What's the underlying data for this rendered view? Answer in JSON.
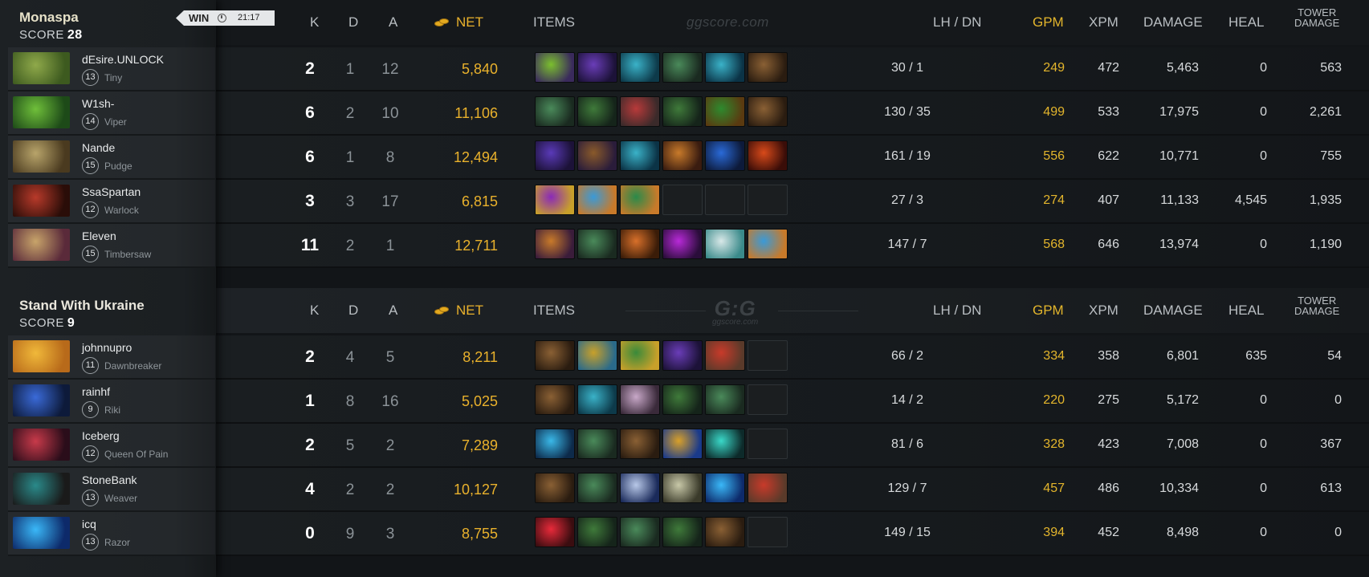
{
  "result": {
    "label": "WIN",
    "time": "21:17"
  },
  "headers": {
    "k": "K",
    "d": "D",
    "a": "A",
    "net": "NET",
    "items": "ITEMS",
    "lhdn": "LH  /  DN",
    "gpm": "GPM",
    "xpm": "XPM",
    "damage": "DAMAGE",
    "heal": "HEAL",
    "tower1": "TOWER",
    "tower2": "DAMAGE",
    "watermark": "ggscore.com",
    "watermark_logo": "G:G",
    "watermark_sub": "ggscore.com"
  },
  "teams": [
    {
      "name": "Monaspa",
      "score_label": "SCORE",
      "score": "28",
      "players": [
        {
          "name": "dEsire.UNLOCK",
          "level": "13",
          "hero": "Tiny",
          "k": "2",
          "d": "1",
          "a": "12",
          "net": "5,840",
          "lhdn": "30  /  1",
          "gpm": "249",
          "xpm": "472",
          "damage": "5,463",
          "heal": "0",
          "tower": "563",
          "portrait": [
            "#8fa94a",
            "#3d5a1f"
          ],
          "items": [
            [
              "#7bbf2e",
              "#3a2a5c"
            ],
            [
              "#6a3db8",
              "#1c1238"
            ],
            [
              "#3ab2c8",
              "#0d3a4a"
            ],
            [
              "#4a8a5a",
              "#1a2a20"
            ],
            [
              "#3ab2c8",
              "#0b3346"
            ],
            [
              "#8a6034",
              "#2a1c10"
            ]
          ]
        },
        {
          "name": "W1sh-",
          "level": "14",
          "hero": "Viper",
          "k": "6",
          "d": "2",
          "a": "10",
          "net": "11,106",
          "lhdn": "130  /  35",
          "gpm": "499",
          "xpm": "533",
          "damage": "17,975",
          "heal": "0",
          "tower": "2,261",
          "portrait": [
            "#6fbf3a",
            "#1d4a18"
          ],
          "items": [
            [
              "#4a8a5a",
              "#1a2a20"
            ],
            [
              "#3f7a3a",
              "#15241a"
            ],
            [
              "#b83a3a",
              "#3a2a2a"
            ],
            [
              "#3f7a3a",
              "#15241a"
            ],
            [
              "#2e8a2e",
              "#5a3a10"
            ],
            [
              "#8a6034",
              "#2a1c10"
            ]
          ]
        },
        {
          "name": "Nande",
          "level": "15",
          "hero": "Pudge",
          "k": "6",
          "d": "1",
          "a": "8",
          "net": "12,494",
          "lhdn": "161  /  19",
          "gpm": "556",
          "xpm": "622",
          "damage": "10,771",
          "heal": "0",
          "tower": "755",
          "portrait": [
            "#b8a46a",
            "#4a3a1f"
          ],
          "items": [
            [
              "#5a3ab8",
              "#1c1238"
            ],
            [
              "#8a5a2a",
              "#2a1c3a"
            ],
            [
              "#3ab2c8",
              "#0b3346"
            ],
            [
              "#c87a2a",
              "#3a1c10"
            ],
            [
              "#2a6ad8",
              "#0d1a3a"
            ],
            [
              "#d84a1a",
              "#3a0d08"
            ]
          ]
        },
        {
          "name": "SsaSpartan",
          "level": "12",
          "hero": "Warlock",
          "k": "3",
          "d": "3",
          "a": "17",
          "net": "6,815",
          "lhdn": "27  /  3",
          "gpm": "274",
          "xpm": "407",
          "damage": "11,133",
          "heal": "4,545",
          "tower": "1,935",
          "portrait": [
            "#b83a2a",
            "#2a0d08"
          ],
          "items": [
            [
              "#8a2ab8",
              "#c8a02a"
            ],
            [
              "#3a9ad8",
              "#c87a2a"
            ],
            [
              "#2a8a4a",
              "#c87a2a"
            ],
            null,
            null,
            null
          ]
        },
        {
          "name": "Eleven",
          "level": "15",
          "hero": "Timbersaw",
          "k": "11",
          "d": "2",
          "a": "1",
          "net": "12,711",
          "lhdn": "147  /  7",
          "gpm": "568",
          "xpm": "646",
          "damage": "13,974",
          "heal": "0",
          "tower": "1,190",
          "portrait": [
            "#c8a46a",
            "#5a2a3a"
          ],
          "items": [
            [
              "#c87a2a",
              "#3a1c3a"
            ],
            [
              "#4a8a5a",
              "#1a2a20"
            ],
            [
              "#d8702a",
              "#3a1c08"
            ],
            [
              "#b82ad8",
              "#2a0d3a"
            ],
            [
              "#d8e8e8",
              "#3a8a8a"
            ],
            [
              "#3a9ad8",
              "#c87a2a"
            ]
          ]
        }
      ]
    },
    {
      "name": "Stand With Ukraine",
      "score_label": "SCORE",
      "score": "9",
      "players": [
        {
          "name": "johnnupro",
          "level": "11",
          "hero": "Dawnbreaker",
          "k": "2",
          "d": "4",
          "a": "5",
          "net": "8,211",
          "lhdn": "66  /  2",
          "gpm": "334",
          "xpm": "358",
          "damage": "6,801",
          "heal": "635",
          "tower": "54",
          "portrait": [
            "#f0b83a",
            "#b86a1a"
          ],
          "items": [
            [
              "#8a6034",
              "#2a1c10"
            ],
            [
              "#c8a02a",
              "#2a6a8a"
            ],
            [
              "#3a8a3a",
              "#c8a02a"
            ],
            [
              "#6a3db8",
              "#1c1238"
            ],
            [
              "#c83a2a",
              "#5a3a2a"
            ],
            null
          ]
        },
        {
          "name": "rainhf",
          "level": "9",
          "hero": "Riki",
          "k": "1",
          "d": "8",
          "a": "16",
          "net": "5,025",
          "lhdn": "14  /  2",
          "gpm": "220",
          "xpm": "275",
          "damage": "5,172",
          "heal": "0",
          "tower": "0",
          "portrait": [
            "#3a6ad8",
            "#0d1a3a"
          ],
          "items": [
            [
              "#8a6034",
              "#2a1c10"
            ],
            [
              "#3ab2c8",
              "#0d3a4a"
            ],
            [
              "#c8a8c8",
              "#3a2a3a"
            ],
            [
              "#3f7a3a",
              "#15241a"
            ],
            [
              "#4a8a5a",
              "#1a2a20"
            ],
            null
          ]
        },
        {
          "name": "Iceberg",
          "level": "12",
          "hero": "Queen Of Pain",
          "k": "2",
          "d": "5",
          "a": "2",
          "net": "7,289",
          "lhdn": "81  /  6",
          "gpm": "328",
          "xpm": "423",
          "damage": "7,008",
          "heal": "0",
          "tower": "367",
          "portrait": [
            "#c83a4a",
            "#2a0d1a"
          ],
          "items": [
            [
              "#3ab8e8",
              "#0d2a4a"
            ],
            [
              "#4a8a5a",
              "#1a2a20"
            ],
            [
              "#8a6034",
              "#2a1c10"
            ],
            [
              "#d8a02a",
              "#1a3a8a"
            ],
            [
              "#3ad8c8",
              "#0d2a2a"
            ],
            null
          ]
        },
        {
          "name": "StoneBank",
          "level": "13",
          "hero": "Weaver",
          "k": "4",
          "d": "2",
          "a": "2",
          "net": "10,127",
          "lhdn": "129  /  7",
          "gpm": "457",
          "xpm": "486",
          "damage": "10,334",
          "heal": "0",
          "tower": "613",
          "portrait": [
            "#2a8a8a",
            "#1a1a1a"
          ],
          "items": [
            [
              "#8a6034",
              "#2a1c10"
            ],
            [
              "#4a8a5a",
              "#1a2a20"
            ],
            [
              "#b8c8e8",
              "#1a2a5a"
            ],
            [
              "#c8c8a8",
              "#3a3a2a"
            ],
            [
              "#3ab8f8",
              "#0d2a6a"
            ],
            [
              "#c83a2a",
              "#5a3a2a"
            ]
          ]
        },
        {
          "name": "icq",
          "level": "13",
          "hero": "Razor",
          "k": "0",
          "d": "9",
          "a": "3",
          "net": "8,755",
          "lhdn": "149  /  15",
          "gpm": "394",
          "xpm": "452",
          "damage": "8,498",
          "heal": "0",
          "tower": "0",
          "portrait": [
            "#3ab8f8",
            "#0d2a6a"
          ],
          "items": [
            [
              "#e82a3a",
              "#3a0d10"
            ],
            [
              "#3f7a3a",
              "#15241a"
            ],
            [
              "#4a8a5a",
              "#1a2a20"
            ],
            [
              "#3f7a3a",
              "#15241a"
            ],
            [
              "#8a6034",
              "#2a1c10"
            ],
            null
          ]
        }
      ]
    }
  ]
}
